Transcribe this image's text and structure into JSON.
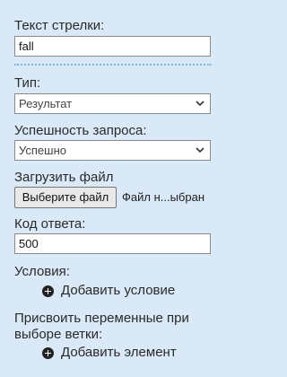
{
  "arrow_text": {
    "label": "Текст стрелки:",
    "value": "fall"
  },
  "type": {
    "label": "Тип:",
    "selected": "Результат"
  },
  "request_success": {
    "label": "Успешность запроса:",
    "selected": "Успешно"
  },
  "upload": {
    "label": "Загрузить файл",
    "button": "Выберите файл",
    "status": "Файл н...ыбран"
  },
  "response_code": {
    "label": "Код ответа:",
    "value": "500"
  },
  "conditions": {
    "label": "Условия:",
    "add": "Добавить условие"
  },
  "assign": {
    "label_line1": "Присвоить переменные при",
    "label_line2": "выборе ветки:",
    "add": "Добавить элемент"
  },
  "icons": {
    "chevron": "chevron-down-icon",
    "plus": "plus-circle-icon"
  },
  "colors": {
    "background": "#d9e9f7",
    "divider": "#7fb1dd"
  }
}
